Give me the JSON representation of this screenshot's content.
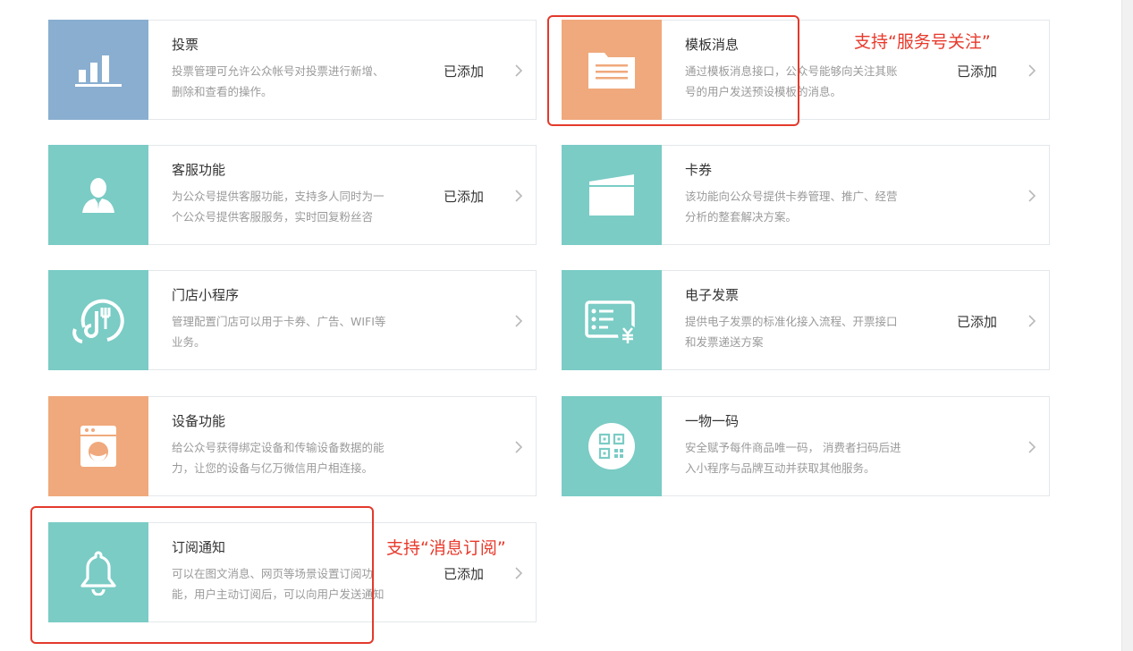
{
  "colors": {
    "blue": "#89aed0",
    "teal": "#7accc5",
    "orange": "#f0a97c",
    "annotation_red": "#e8392b"
  },
  "cards": [
    {
      "title": "投票",
      "desc_lines": [
        "投票管理可允许公众帐号对投票进行新增、",
        "删除和查看的操作。"
      ],
      "status": "已添加",
      "icon": "bar-chart-icon"
    },
    {
      "title": "模板消息",
      "desc_lines": [
        "通过模板消息接口，公众号能够向关注其账",
        "号的用户发送预设模板的消息。"
      ],
      "status": "已添加",
      "icon": "document-icon"
    },
    {
      "title": "客服功能",
      "desc_lines": [
        "为公众号提供客服功能，支持多人同时为一",
        "个公众号提供客服服务，实时回复粉丝咨"
      ],
      "status": "已添加",
      "icon": "person-icon"
    },
    {
      "title": "卡券",
      "desc_lines": [
        "该功能向公众号提供卡券管理、推广、经营",
        "分析的整套解决方案。"
      ],
      "status": "",
      "icon": "wallet-icon"
    },
    {
      "title": "门店小程序",
      "desc_lines": [
        "管理配置门店可以用于卡券、广告、WIFI等",
        "业务。"
      ],
      "status": "",
      "icon": "store-fork-icon"
    },
    {
      "title": "电子发票",
      "desc_lines": [
        "提供电子发票的标准化接入流程、开票接口",
        "和发票递送方案"
      ],
      "status": "已添加",
      "icon": "invoice-icon"
    },
    {
      "title": "设备功能",
      "desc_lines": [
        "给公众号获得绑定设备和传输设备数据的能",
        "力，让您的设备与亿万微信用户相连接。"
      ],
      "status": "",
      "icon": "washing-machine-icon"
    },
    {
      "title": "一物一码",
      "desc_lines": [
        "安全赋予每件商品唯一码， 消费者扫码后进",
        "入小程序与品牌互动并获取其他服务。"
      ],
      "status": "",
      "icon": "qr-code-icon"
    },
    {
      "title": "订阅通知",
      "desc_lines": [
        "可以在图文消息、网页等场景设置订阅功",
        "能，用户主动订阅后，可以向用户发送通知"
      ],
      "status": "已添加",
      "icon": "bell-icon"
    }
  ],
  "annotations": {
    "template_message": "支持“服务号关注”",
    "subscribe_notice": "支持“消息订阅”"
  }
}
